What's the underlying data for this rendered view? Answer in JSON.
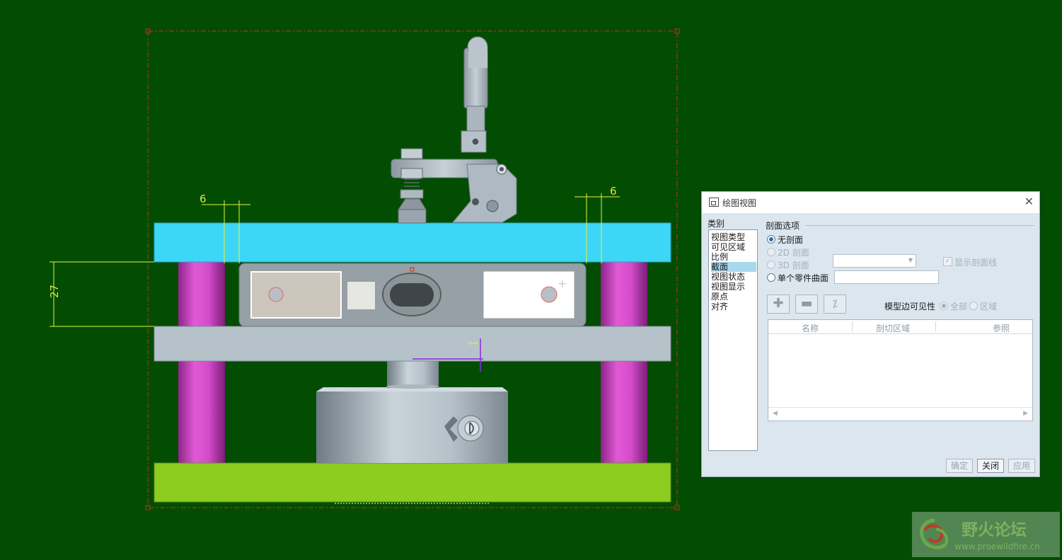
{
  "drawing": {
    "dim_top_left": "6",
    "dim_top_right": "6",
    "dim_height": "27",
    "section_marker": "1"
  },
  "dialog": {
    "title": "绘图视图",
    "close_symbol": "✕",
    "category_label": "类别",
    "categories": [
      "视图类型",
      "可见区域",
      "比例",
      "截面",
      "视图状态",
      "视图显示",
      "原点",
      "对齐"
    ],
    "selected_category": "截面",
    "section_options_label": "剖面选项",
    "options": {
      "none": "无剖面",
      "two_d": "2D 剖面",
      "three_d": "3D 剖面",
      "single_surface": "单个零件曲面"
    },
    "selected_option": "无剖面",
    "show_hatch_label": "显示剖面线",
    "model_edge_visibility_label": "模型边可见性",
    "visibility_all": "全部",
    "visibility_area": "区域",
    "table_headers": [
      "名称",
      "剖切区域",
      "参照"
    ],
    "buttons": {
      "ok": "确定",
      "close": "关闭",
      "apply": "应用"
    },
    "tool_buttons": [
      "add",
      "remove",
      "flip"
    ]
  },
  "watermark": {
    "title": "野火论坛",
    "url": "www.proewildfire.cn"
  },
  "colors": {
    "background": "#034d03",
    "top_plate": "#3dd6f7",
    "pillars": "#d246c6",
    "base_plate": "#8ccd20",
    "border_dash": "#e02020",
    "dimension": "#e6f23c"
  }
}
